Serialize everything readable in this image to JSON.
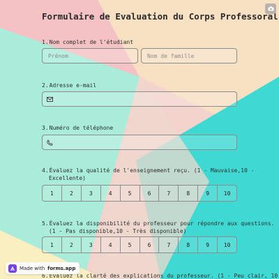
{
  "form": {
    "title": "Formulaire de Evaluation du Corps Professoral"
  },
  "questions": [
    {
      "number": "1.",
      "label": "Nom complet de l'étudiant",
      "first_name_placeholder": "Prénom",
      "last_name_placeholder": "Nom de famille"
    },
    {
      "number": "2.",
      "label": "Adresse e-mail",
      "icon": "envelope-icon"
    },
    {
      "number": "3.",
      "label": "Numéro de téléphone",
      "icon": "phone-icon"
    },
    {
      "number": "4.",
      "line1": "Évaluez la qualité de l'enseignement reçu. (1 - Mauvaise,10 -",
      "line2": "Excellente)",
      "scale": [
        "1",
        "2",
        "3",
        "4",
        "5",
        "6",
        "7",
        "8",
        "9",
        "10"
      ]
    },
    {
      "number": "5.",
      "line1": "Évaluez la disponibilité du professeur pour répondre aux questions.",
      "line2": "(1 - Pas disponible,10 - Très disponible)",
      "scale": [
        "1",
        "2",
        "3",
        "4",
        "5",
        "6",
        "7",
        "8",
        "9",
        "10"
      ]
    },
    {
      "number": "6.",
      "line1": "Évaluez la clarté des explications du professeur. (1 - Peu clair, 10"
    }
  ],
  "badge": {
    "prefix": "Made with",
    "brand": "forms.app"
  },
  "colors": {
    "accent": "#7b3fe4",
    "teal": "#3fd9d3",
    "peach": "#f7dfc0",
    "pink": "#f5c3bd"
  }
}
